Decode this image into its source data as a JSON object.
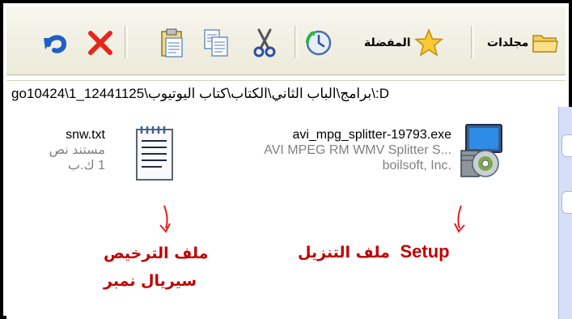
{
  "toolbar": {
    "folders_label": "مجلدات",
    "favorites_label": "المفضلة"
  },
  "address": {
    "path": "D:\\برامج\\الباب الثاني\\الكتاب\\كتاب اليوتيوب\\go10424\\1_12441125"
  },
  "files": [
    {
      "name": "avi_mpg_splitter-19793.exe",
      "description": "AVI MPEG RM WMV Splitter S...",
      "company": "boilsoft, Inc."
    },
    {
      "name": "snw.txt",
      "type": "مستند نص",
      "size": "1 ك.ب"
    }
  ],
  "annotations": {
    "setup_word": "Setup",
    "setup_rest": "ملف التنزيل",
    "license_line1": "ملف الترخيص",
    "license_line2": "سيريال نمبر",
    "color": "#c00000"
  },
  "colors": {
    "toolbar_bg": "#ecead8",
    "side_panel": "#d6dff7"
  }
}
